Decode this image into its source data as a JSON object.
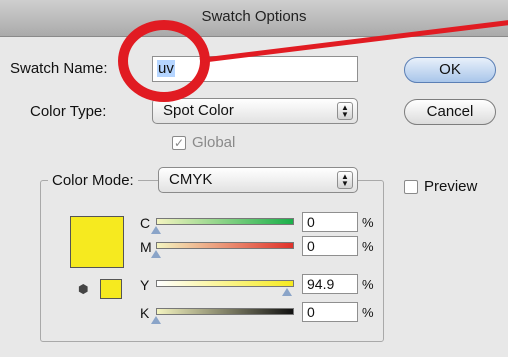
{
  "dialog": {
    "title": "Swatch Options",
    "swatch_name_label": "Swatch Name:",
    "swatch_name_value": "uv",
    "color_type_label": "Color Type:",
    "color_type_value": "Spot Color",
    "global_label": "Global",
    "global_checked": true,
    "color_mode_label": "Color Mode:",
    "color_mode_value": "CMYK",
    "preview_label": "Preview",
    "preview_checked": false,
    "ok_label": "OK",
    "cancel_label": "Cancel",
    "swatch_color": "#f6ea1f",
    "channels": [
      {
        "label": "C",
        "value": "0",
        "unit": "%",
        "level": 0
      },
      {
        "label": "M",
        "value": "0",
        "unit": "%",
        "level": 0
      },
      {
        "label": "Y",
        "value": "94.9",
        "unit": "%",
        "level": 0.949
      },
      {
        "label": "K",
        "value": "0",
        "unit": "%",
        "level": 0
      }
    ],
    "annotation_color": "#e11b22"
  }
}
